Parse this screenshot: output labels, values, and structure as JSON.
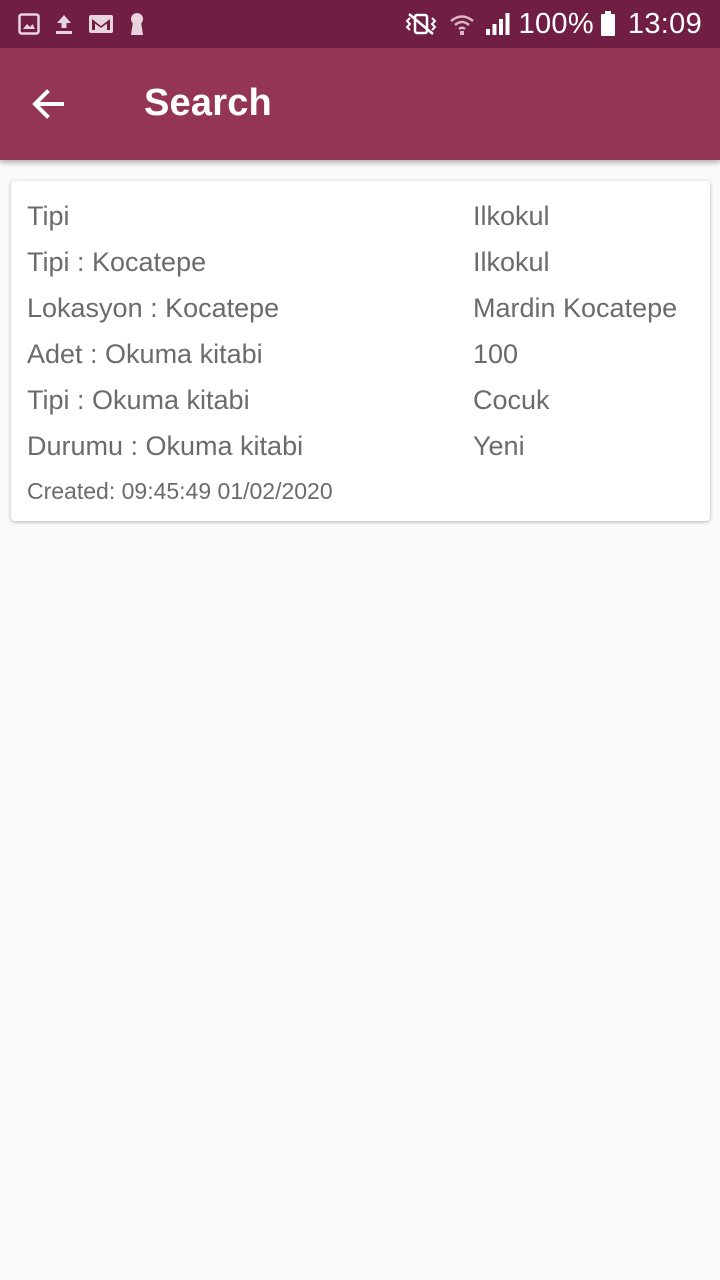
{
  "status_bar": {
    "left_icons": [
      "image-icon",
      "upload-icon",
      "gmail-icon",
      "keyhole-icon"
    ],
    "right_icons": [
      "vibrate-icon",
      "wifi-icon",
      "signal-icon"
    ],
    "battery": "100%",
    "time": "13:09"
  },
  "toolbar": {
    "back_icon": "arrow-left-icon",
    "title": "Search"
  },
  "result": {
    "rows": [
      {
        "label": "Tipi",
        "value": "Ilkokul"
      },
      {
        "label": "Tipi : Kocatepe",
        "value": "Ilkokul"
      },
      {
        "label": "Lokasyon : Kocatepe",
        "value": "Mardin Kocatepe"
      },
      {
        "label": "Adet : Okuma kitabi",
        "value": "100"
      },
      {
        "label": "Tipi : Okuma kitabi",
        "value": "Cocuk"
      },
      {
        "label": "Durumu : Okuma kitabi",
        "value": "Yeni"
      }
    ],
    "created": "Created: 09:45:49 01/02/2020"
  },
  "colors": {
    "status_bar": "#701e44",
    "toolbar": "#943554",
    "text": "#6b6b6b",
    "background": "#fafafa"
  }
}
